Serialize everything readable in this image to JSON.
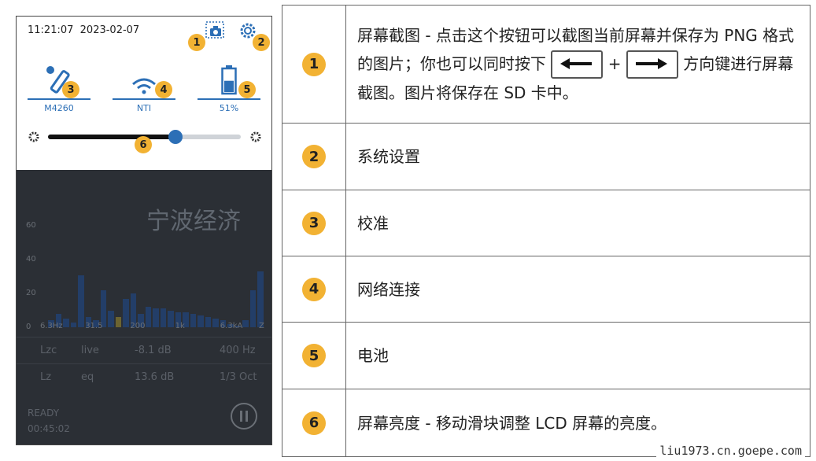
{
  "device": {
    "time": "11:21:07",
    "date": "2023-02-07",
    "tiles": [
      {
        "label": "M4260",
        "badge": "3",
        "icon": "mic-calibration-icon"
      },
      {
        "label": "NTI",
        "badge": "4",
        "icon": "wifi-icon"
      },
      {
        "label": "51%",
        "badge": "5",
        "icon": "battery-icon"
      }
    ],
    "badges": {
      "camera": "1",
      "gear": "2",
      "slider": "6"
    },
    "brightness": 0.66,
    "y_ticks": [
      "60",
      "40",
      "20",
      "0"
    ],
    "x_ticks": [
      "6.3Hz",
      "31.5",
      "200",
      "1k",
      "6.3kA",
      "Z"
    ],
    "rows": [
      {
        "name": "Lzc",
        "mode": "live",
        "value": "-8.1 dB",
        "right": "400 Hz"
      },
      {
        "name": "Lz",
        "mode": "eq",
        "value": "13.6 dB",
        "right": "1/3 Oct"
      }
    ],
    "status": "READY",
    "elapsed": "00:45:02",
    "watermark": "宁波经济"
  },
  "chart_data": {
    "type": "bar",
    "x_tick_labels": [
      "6.3Hz",
      "31.5",
      "200",
      "1k",
      "6.3kA",
      "Z"
    ],
    "values": [
      4,
      8,
      5,
      3,
      31,
      6,
      4,
      22,
      10,
      6,
      17,
      20,
      8,
      12,
      11,
      11,
      10,
      9,
      9,
      8,
      7,
      6,
      5,
      4,
      2,
      1,
      4,
      22,
      33
    ],
    "ylim": [
      0,
      70
    ],
    "grid": false
  },
  "table": {
    "rows": [
      {
        "num": "1",
        "parts": [
          "屏幕截图 - 点击这个按钮可以截图当前屏幕并保存为 PNG 格式的图片；你也可以同时按下 ",
          " + ",
          " 方向键进行屏幕截图。图片将保存在 SD 卡中。"
        ]
      },
      {
        "num": "2",
        "text": "系统设置"
      },
      {
        "num": "3",
        "text": "校准"
      },
      {
        "num": "4",
        "text": "网络连接"
      },
      {
        "num": "5",
        "text": "电池"
      },
      {
        "num": "6",
        "text": "屏幕亮度 - 移动滑块调整 LCD 屏幕的亮度。"
      }
    ]
  },
  "footer": {
    "url": "liu1973.cn.goepe.com"
  },
  "colors": {
    "badge": "#f2b233",
    "accent": "#2c6fb6",
    "dark_panel": "#2b2f35"
  }
}
